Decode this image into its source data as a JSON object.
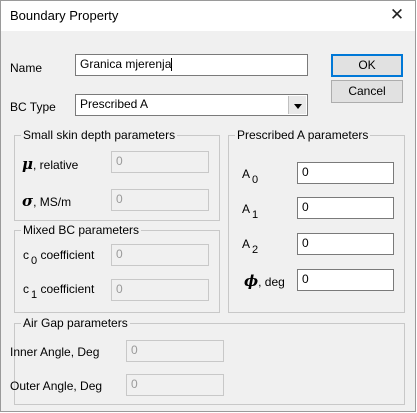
{
  "window": {
    "title": "Boundary Property"
  },
  "name_row": {
    "label": "Name",
    "value": "Granica mjerenja"
  },
  "buttons": {
    "ok": "OK",
    "cancel": "Cancel"
  },
  "bc_type": {
    "label": "BC Type",
    "value": "Prescribed A"
  },
  "small_skin": {
    "title": "Small skin depth parameters",
    "mu_symbol": "μ",
    "mu_label": ", relative",
    "mu_value": "0",
    "sigma_symbol": "σ",
    "sigma_label": ", MS/m",
    "sigma_value": "0"
  },
  "mixed": {
    "title": "Mixed BC parameters",
    "c0_prefix": "c",
    "c0_sub": "0",
    "c0_label": "coefficient",
    "c0_value": "0",
    "c1_prefix": "c",
    "c1_sub": "1",
    "c1_label": "coefficient",
    "c1_value": "0"
  },
  "prescribed": {
    "title": "Prescribed A parameters",
    "a0_prefix": "A",
    "a0_sub": "0",
    "a0_value": "0",
    "a1_prefix": "A",
    "a1_sub": "1",
    "a1_value": "0",
    "a2_prefix": "A",
    "a2_sub": "2",
    "a2_value": "0",
    "phi_symbol": "ϕ",
    "phi_label": ", deg",
    "phi_value": "0"
  },
  "airgap": {
    "title": "Air Gap parameters",
    "inner_label": "Inner Angle, Deg",
    "inner_value": "0",
    "outer_label": "Outer Angle, Deg",
    "outer_value": "0"
  },
  "icons": {
    "close": "close-icon",
    "dropdown": "chevron-down-icon"
  },
  "colors": {
    "default_button_border": "#0078d7",
    "dialog_bg": "#f0f0f0"
  }
}
